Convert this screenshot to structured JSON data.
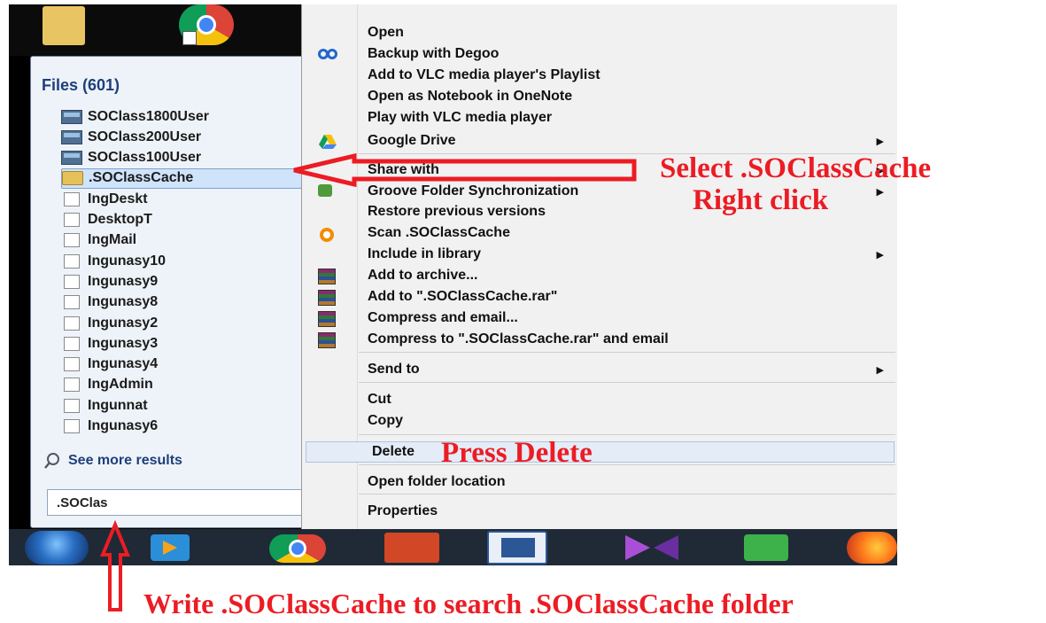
{
  "start_menu": {
    "files_header": "Files (601)",
    "files": [
      {
        "label": "SOClass1800User",
        "icon": "exe"
      },
      {
        "label": "SOClass200User",
        "icon": "exe"
      },
      {
        "label": "SOClass100User",
        "icon": "exe"
      },
      {
        "label": ".SOClassCache",
        "icon": "folder",
        "selected": true
      },
      {
        "label": "IngDeskt",
        "icon": "file"
      },
      {
        "label": "DesktopT",
        "icon": "file"
      },
      {
        "label": "IngMail",
        "icon": "file"
      },
      {
        "label": "Ingunasy10",
        "icon": "file"
      },
      {
        "label": "Ingunasy9",
        "icon": "file"
      },
      {
        "label": "Ingunasy8",
        "icon": "file"
      },
      {
        "label": "Ingunasy2",
        "icon": "file"
      },
      {
        "label": "Ingunasy3",
        "icon": "file"
      },
      {
        "label": "Ingunasy4",
        "icon": "file"
      },
      {
        "label": "IngAdmin",
        "icon": "file"
      },
      {
        "label": "Ingunnat",
        "icon": "file"
      },
      {
        "label": "Ingunasy6",
        "icon": "file"
      }
    ],
    "see_more": "See more results",
    "search_value": ".SOClas"
  },
  "context_menu": {
    "items": [
      {
        "label": "Open",
        "icon": ""
      },
      {
        "label": "Backup with Degoo",
        "icon": "degoo-icon"
      },
      {
        "label": "Add to VLC media player's Playlist",
        "icon": ""
      },
      {
        "label": "Open as Notebook in OneNote",
        "icon": ""
      },
      {
        "label": "Play with VLC media player",
        "icon": ""
      },
      {
        "label": "Google Drive",
        "icon": "google-drive-icon",
        "submenu": true
      },
      {
        "label": "Share with",
        "icon": "",
        "submenu": true
      },
      {
        "label": "Groove Folder Synchronization",
        "icon": "groove-icon",
        "submenu": true
      },
      {
        "label": "Restore previous versions",
        "icon": ""
      },
      {
        "label": "Scan .SOClassCache",
        "icon": "avast-icon"
      },
      {
        "label": "Include in library",
        "icon": "",
        "submenu": true
      },
      {
        "label": "Add to archive...",
        "icon": "winrar-icon"
      },
      {
        "label": "Add to \".SOClassCache.rar\"",
        "icon": "winrar-icon"
      },
      {
        "label": "Compress and email...",
        "icon": "winrar-icon"
      },
      {
        "label": "Compress to \".SOClassCache.rar\" and email",
        "icon": "winrar-icon"
      },
      {
        "label": "Send to",
        "icon": "",
        "submenu": true
      },
      {
        "label": "Cut",
        "icon": ""
      },
      {
        "label": "Copy",
        "icon": ""
      },
      {
        "label": "Delete",
        "icon": "",
        "highlighted": true
      },
      {
        "label": "Open folder location",
        "icon": ""
      },
      {
        "label": "Properties",
        "icon": ""
      }
    ]
  },
  "annotations": {
    "select": "Select .SOClassCache",
    "right_click": "Right click",
    "press_delete": "Press Delete",
    "write": "Write .SOClassCache to search .SOClassCache folder"
  },
  "colors": {
    "annotation_red": "#ec1c24",
    "files_header_blue": "#1e3f7a",
    "taskbar": "#1f2a36"
  }
}
